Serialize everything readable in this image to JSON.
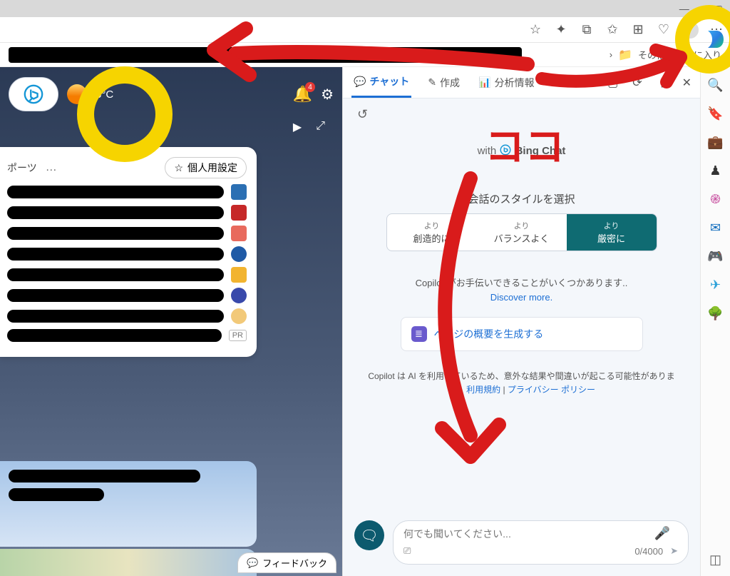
{
  "bookmarks": {
    "overflow_label": "その他のお気に入り"
  },
  "left": {
    "temperature": "5°C",
    "notification_count": "4",
    "sports_label": "ポーツ",
    "personalize_label": "個人用設定",
    "pr_label": "PR",
    "feedback_label": "フィードバック"
  },
  "chat": {
    "tabs": {
      "chat": "チャット",
      "compose": "作成",
      "insights": "分析情報"
    },
    "branding_prefix": "with",
    "branding": "Bing Chat",
    "style_heading": "会話のスタイルを選択",
    "styles": {
      "prefix": "より",
      "creative": "創造的に",
      "balanced": "バランスよく",
      "precise": "厳密に"
    },
    "help_text": "Copilot がお手伝いできることがいくつかあります..",
    "discover": "Discover more.",
    "summary_button": "ページの概要を生成する",
    "disclaimer_text": "Copilot は AI を利用しているため、意外な結果や間違いが起こる可能性があります。",
    "terms_label": "利用規約",
    "separator": " | ",
    "privacy_label": "プライバシー ポリシー",
    "input_placeholder": "何でも聞いてください...",
    "char_counter": "0/4000"
  },
  "annotation": {
    "koko": "ココ"
  },
  "icons": {
    "minimize": "—",
    "maximize": "▢",
    "chevron_right": "›",
    "bell": "🔔",
    "gear": "⚙",
    "play": "▶",
    "expand": "⤢",
    "star": "☆",
    "history": "↺",
    "open": "▢",
    "refresh": "⟳",
    "more": "⋮",
    "close": "✕",
    "mic": "🎤",
    "camera": "⎚",
    "send": "➤",
    "folder": "📁",
    "search": "🔍",
    "tag": "🔖",
    "briefcase": "💼",
    "chess": "♟",
    "spiral": "֎",
    "outlook": "✉",
    "game": "🎮",
    "telegram": "✈",
    "tree": "🌳",
    "split": "◫",
    "compose": "✎",
    "insights": "📊",
    "chat": "💬",
    "newtopic": "🗨",
    "collections": "⧉",
    "favorites": "✩",
    "heart": "♡",
    "feedback": "💬"
  }
}
